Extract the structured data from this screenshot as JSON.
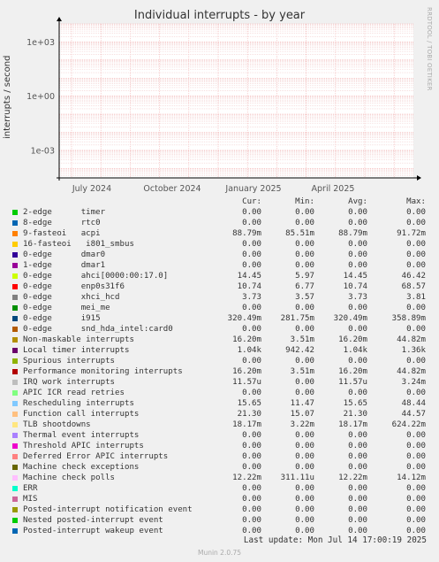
{
  "chart_data": {
    "type": "line",
    "title": "Individual interrupts - by year",
    "ylabel": "interrupts / second",
    "yscale": "log",
    "ylim": [
      3e-05,
      10000
    ],
    "y_ticks": [
      "1e+03",
      "1e+00",
      "1e-03"
    ],
    "x_ticks": [
      "July 2024",
      "October 2024",
      "January 2025",
      "April 2025"
    ],
    "grid": true,
    "series": []
  },
  "side_label": "RRDTOOL / TOBI OETIKER",
  "legend": {
    "headers": [
      "Cur:",
      "Min:",
      "Avg:",
      "Max:"
    ],
    "rows": [
      {
        "name": "2-edge      timer",
        "color": "#00cc00",
        "cur": "0.00",
        "min": "0.00",
        "avg": "0.00",
        "max": "0.00"
      },
      {
        "name": "8-edge      rtc0",
        "color": "#0066b3",
        "cur": "0.00",
        "min": "0.00",
        "avg": "0.00",
        "max": "0.00"
      },
      {
        "name": "9-fasteoi   acpi",
        "color": "#ff8000",
        "cur": "88.79m",
        "min": "85.51m",
        "avg": "88.79m",
        "max": "91.72m"
      },
      {
        "name": "16-fasteoi   i801_smbus",
        "color": "#ffcc00",
        "cur": "0.00",
        "min": "0.00",
        "avg": "0.00",
        "max": "0.00"
      },
      {
        "name": "0-edge      dmar0",
        "color": "#330099",
        "cur": "0.00",
        "min": "0.00",
        "avg": "0.00",
        "max": "0.00"
      },
      {
        "name": "1-edge      dmar1",
        "color": "#990099",
        "cur": "0.00",
        "min": "0.00",
        "avg": "0.00",
        "max": "0.00"
      },
      {
        "name": "0-edge      ahci[0000:00:17.0]",
        "color": "#ccff00",
        "cur": "14.45",
        "min": "5.97",
        "avg": "14.45",
        "max": "46.42"
      },
      {
        "name": "0-edge      enp0s31f6",
        "color": "#ff0000",
        "cur": "10.74",
        "min": "6.77",
        "avg": "10.74",
        "max": "68.57"
      },
      {
        "name": "0-edge      xhci_hcd",
        "color": "#808080",
        "cur": "3.73",
        "min": "3.57",
        "avg": "3.73",
        "max": "3.81"
      },
      {
        "name": "0-edge      mei_me",
        "color": "#008f00",
        "cur": "0.00",
        "min": "0.00",
        "avg": "0.00",
        "max": "0.00"
      },
      {
        "name": "0-edge      i915",
        "color": "#00487d",
        "cur": "320.49m",
        "min": "281.75m",
        "avg": "320.49m",
        "max": "358.89m"
      },
      {
        "name": "0-edge      snd_hda_intel:card0",
        "color": "#b35a00",
        "cur": "0.00",
        "min": "0.00",
        "avg": "0.00",
        "max": "0.00"
      },
      {
        "name": "Non-maskable interrupts",
        "color": "#b38f00",
        "cur": "16.20m",
        "min": "3.51m",
        "avg": "16.20m",
        "max": "44.82m"
      },
      {
        "name": "Local timer interrupts",
        "color": "#6b006b",
        "cur": "1.04k",
        "min": "942.42",
        "avg": "1.04k",
        "max": "1.36k"
      },
      {
        "name": "Spurious interrupts",
        "color": "#8fb300",
        "cur": "0.00",
        "min": "0.00",
        "avg": "0.00",
        "max": "0.00"
      },
      {
        "name": "Performance monitoring interrupts",
        "color": "#b30000",
        "cur": "16.20m",
        "min": "3.51m",
        "avg": "16.20m",
        "max": "44.82m"
      },
      {
        "name": "IRQ work interrupts",
        "color": "#bebebe",
        "cur": "11.57u",
        "min": "0.00",
        "avg": "11.57u",
        "max": "3.24m"
      },
      {
        "name": "APIC ICR read retries",
        "color": "#80ff80",
        "cur": "0.00",
        "min": "0.00",
        "avg": "0.00",
        "max": "0.00"
      },
      {
        "name": "Rescheduling interrupts",
        "color": "#80c9ff",
        "cur": "15.65",
        "min": "11.47",
        "avg": "15.65",
        "max": "48.44"
      },
      {
        "name": "Function call interrupts",
        "color": "#ffc080",
        "cur": "21.30",
        "min": "15.07",
        "avg": "21.30",
        "max": "44.57"
      },
      {
        "name": "TLB shootdowns",
        "color": "#ffe680",
        "cur": "18.17m",
        "min": "3.22m",
        "avg": "18.17m",
        "max": "624.22m"
      },
      {
        "name": "Thermal event interrupts",
        "color": "#aa80ff",
        "cur": "0.00",
        "min": "0.00",
        "avg": "0.00",
        "max": "0.00"
      },
      {
        "name": "Threshold APIC interrupts",
        "color": "#ee00cc",
        "cur": "0.00",
        "min": "0.00",
        "avg": "0.00",
        "max": "0.00"
      },
      {
        "name": "Deferred Error APIC interrupts",
        "color": "#ff8080",
        "cur": "0.00",
        "min": "0.00",
        "avg": "0.00",
        "max": "0.00"
      },
      {
        "name": "Machine check exceptions",
        "color": "#666600",
        "cur": "0.00",
        "min": "0.00",
        "avg": "0.00",
        "max": "0.00"
      },
      {
        "name": "Machine check polls",
        "color": "#ffbfff",
        "cur": "12.22m",
        "min": "311.11u",
        "avg": "12.22m",
        "max": "14.12m"
      },
      {
        "name": "ERR",
        "color": "#00ffcc",
        "cur": "0.00",
        "min": "0.00",
        "avg": "0.00",
        "max": "0.00"
      },
      {
        "name": "MIS",
        "color": "#cc6699",
        "cur": "0.00",
        "min": "0.00",
        "avg": "0.00",
        "max": "0.00"
      },
      {
        "name": "Posted-interrupt notification event",
        "color": "#999900",
        "cur": "0.00",
        "min": "0.00",
        "avg": "0.00",
        "max": "0.00"
      },
      {
        "name": "Nested posted-interrupt event",
        "color": "#00cc00",
        "cur": "0.00",
        "min": "0.00",
        "avg": "0.00",
        "max": "0.00"
      },
      {
        "name": "Posted-interrupt wakeup event",
        "color": "#0066b3",
        "cur": "0.00",
        "min": "0.00",
        "avg": "0.00",
        "max": "0.00"
      }
    ]
  },
  "last_update": "Last update: Mon Jul 14 17:00:19 2025",
  "footer": "Munin 2.0.75"
}
